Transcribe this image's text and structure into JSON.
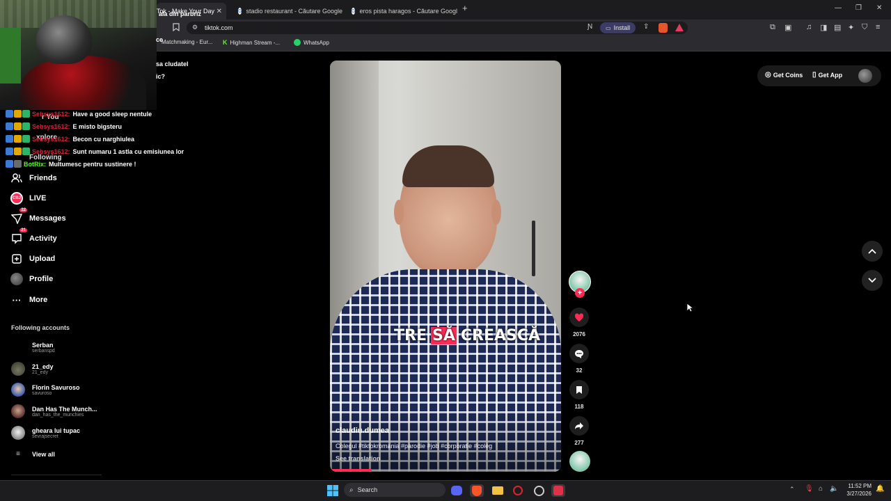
{
  "browser": {
    "tabs": [
      {
        "label": "Tok - Make Your Day"
      },
      {
        "label": "stadio restaurant - Căutare Google"
      },
      {
        "label": "eros pista haragos - Căutare Google"
      }
    ],
    "url": "tiktok.com",
    "install_label": "Install",
    "bookmarks": [
      "Matchmaking - Eur...",
      "Highman Stream -...",
      "WhatsApp"
    ]
  },
  "overlay_stream": {
    "fragments": [
      "ala din parbriz",
      "ce",
      "sa cludatel",
      "ic?"
    ],
    "chat": [
      {
        "user": "Sebsys1612:",
        "message": "Have a good sleep nentule"
      },
      {
        "user": "Sebsys1612:",
        "message": "E misto bigsteru"
      },
      {
        "user": "Sebsys1612:",
        "message": "Becon cu narghiulea"
      },
      {
        "user": "Sebsys1612:",
        "message": "Sunt numaru 1 astla cu emisiunea lor"
      },
      {
        "user": "BotRix:",
        "message": "Multumesc pentru sustinere !"
      }
    ]
  },
  "sidebar": {
    "nav_partial": [
      "r You",
      "xplore",
      "Following"
    ],
    "nav": [
      {
        "label": "Friends",
        "icon": "friends-icon"
      },
      {
        "label": "LIVE",
        "icon": "live-icon"
      },
      {
        "label": "Messages",
        "icon": "messages-icon",
        "badge": "22"
      },
      {
        "label": "Activity",
        "icon": "activity-icon",
        "badge": "21"
      },
      {
        "label": "Upload",
        "icon": "upload-icon"
      },
      {
        "label": "Profile",
        "icon": "profile-icon"
      },
      {
        "label": "More",
        "icon": "more-icon"
      }
    ],
    "following_title": "Following accounts",
    "accounts": [
      {
        "name": "Serban",
        "user": "serbanspd"
      },
      {
        "name": "21_edy",
        "user": "21_edy"
      },
      {
        "name": "Florin Savuroso",
        "user": "savuroso"
      },
      {
        "name": "Dan Has The Munch...",
        "user": "dan_has_the_munchies"
      },
      {
        "name": "gheara lui tupac",
        "user": "sevrajsecret"
      }
    ],
    "view_all": "View all"
  },
  "header": {
    "get_coins": "Get Coins",
    "get_app": "Get App"
  },
  "video": {
    "caption_overlay_1": "TRE",
    "caption_overlay_2": "SĂ",
    "caption_overlay_3": "CREASCĂ",
    "author": "claudiu.dumea",
    "description": "Colegul #tiktokromania #parodie #job #corporatie #coleg",
    "see_translation": "See translation",
    "progress_fraction": 0.18
  },
  "actions": {
    "likes": "2076",
    "comments": "32",
    "saves": "118",
    "shares": "277"
  },
  "taskbar": {
    "search_placeholder": "Search",
    "time": "11:52 PM",
    "date": "3/27/2026"
  },
  "colors": {
    "accent": "#fe2c55",
    "bg": "#000000",
    "chrome": "#2b2b30"
  }
}
